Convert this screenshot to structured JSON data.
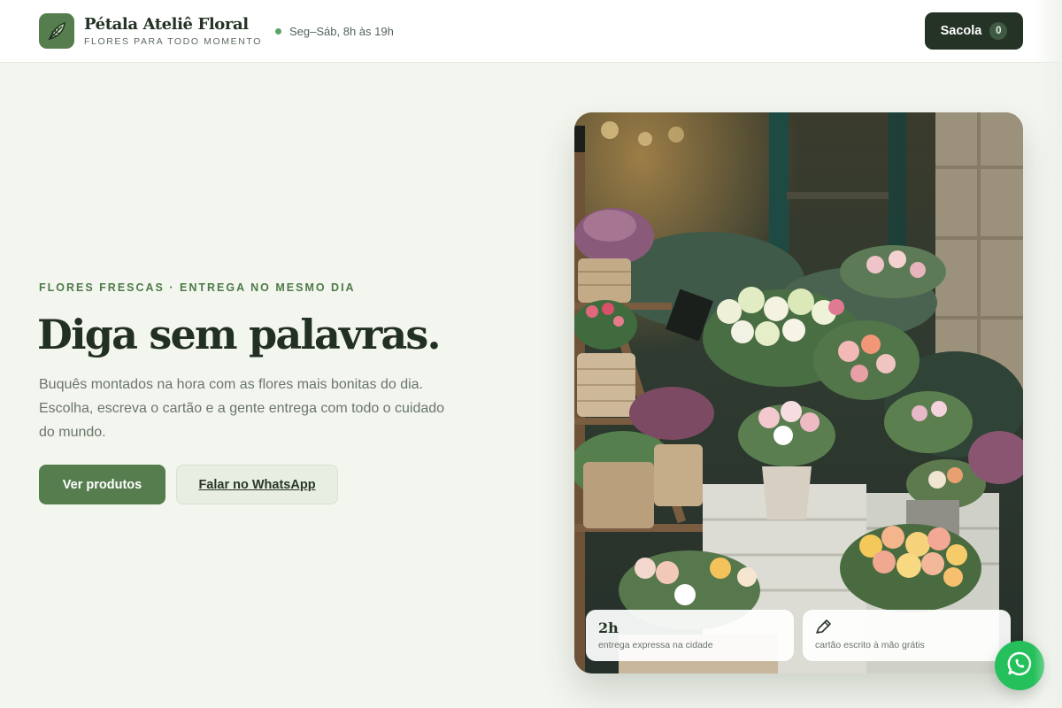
{
  "header": {
    "brand_name": "Pétala Ateliê Floral",
    "brand_tagline": "FLORES PARA TODO MOMENTO",
    "hours": "Seg–Sáb, 8h às 19h",
    "bag_label": "Sacola",
    "bag_count": "0",
    "logo_icon": "leaf-icon"
  },
  "hero": {
    "eyebrow": "FLORES FRESCAS · ENTREGA NO MESMO DIA",
    "title": "Diga sem palavras.",
    "description": "Buquês montados na hora com as flores mais bonitas do dia. Escolha, escreva o cartão e a gente entrega com todo o cuidado do mundo.",
    "primary_button": "Ver produtos",
    "secondary_button": "Falar no WhatsApp"
  },
  "cards": [
    {
      "title": "2h",
      "text": "entrega expressa na cidade"
    },
    {
      "icon": "pen-icon",
      "text": "cartão escrito à mão grátis"
    }
  ],
  "floating": {
    "icon": "whatsapp-icon"
  },
  "colors": {
    "accent": "#567d4e",
    "dark": "#253226",
    "background": "#f3f6ef",
    "whatsapp": "#25c05c"
  }
}
